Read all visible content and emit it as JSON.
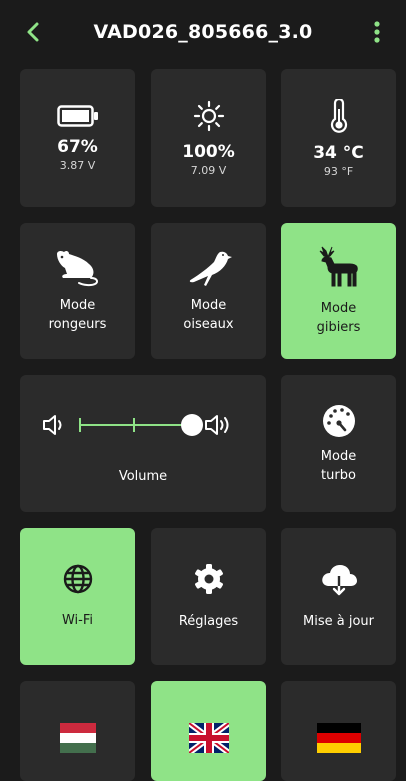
{
  "header": {
    "title": "VAD026_805666_3.0"
  },
  "battery": {
    "percent": "67%",
    "voltage": "3.87 V"
  },
  "solar": {
    "percent": "100%",
    "voltage": "7.09 V"
  },
  "temperature": {
    "celsius": "34 °C",
    "fahrenheit": "93 °F"
  },
  "modes": {
    "rodents": {
      "line1": "Mode",
      "line2": "rongeurs",
      "active": false
    },
    "birds": {
      "line1": "Mode",
      "line2": "oiseaux",
      "active": false
    },
    "game": {
      "line1": "Mode",
      "line2": "gibiers",
      "active": true
    }
  },
  "volume": {
    "label": "Volume",
    "level": 0.85
  },
  "turbo": {
    "line1": "Mode",
    "line2": "turbo"
  },
  "wifi": {
    "label": "Wi-Fi",
    "active": true
  },
  "settings": {
    "label": "Réglages"
  },
  "update": {
    "label": "Mise à jour"
  },
  "languages": [
    {
      "flag": "hungary-flag",
      "active": false
    },
    {
      "flag": "uk-flag",
      "active": true
    },
    {
      "flag": "germany-flag",
      "active": false
    }
  ],
  "colors": {
    "accent": "#8fe387",
    "tile": "#2b2b2b",
    "background": "#1b1b1b"
  }
}
